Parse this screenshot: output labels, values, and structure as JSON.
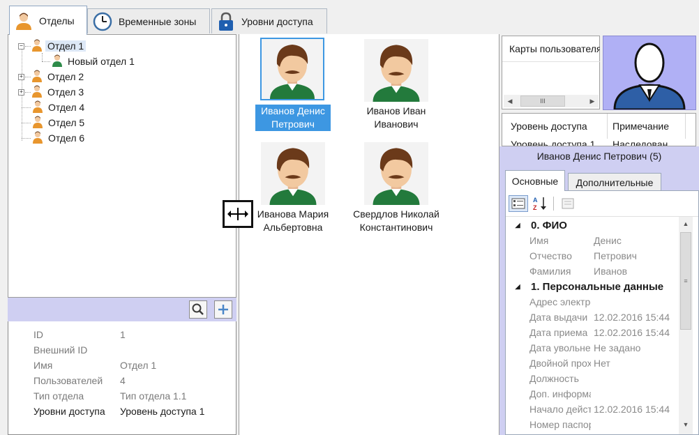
{
  "tabs": [
    {
      "label": "Отделы",
      "icon": "person-icon",
      "active": true
    },
    {
      "label": "Временные зоны",
      "icon": "clock-icon",
      "active": false
    },
    {
      "label": "Уровни доступа",
      "icon": "lock-icon",
      "active": false
    }
  ],
  "tree": {
    "items": [
      {
        "label": "Отдел 1",
        "expander": "−"
      },
      {
        "label": "Новый отдел 1"
      },
      {
        "label": "Отдел 2",
        "expander": "+"
      },
      {
        "label": "Отдел 3",
        "expander": "+"
      },
      {
        "label": "Отдел 4"
      },
      {
        "label": "Отдел 5"
      },
      {
        "label": "Отдел 6"
      }
    ]
  },
  "dept_props": [
    {
      "key": "ID",
      "value": "1"
    },
    {
      "key": "Внешний ID",
      "value": ""
    },
    {
      "key": "Имя",
      "value": "Отдел 1"
    },
    {
      "key": "Пользователей",
      "value": "4"
    },
    {
      "key": "Тип отдела",
      "value": "Тип отдела 1.1"
    },
    {
      "key": "Уровни доступа",
      "value": "Уровень доступа 1"
    }
  ],
  "people": [
    {
      "line1": "Иванов Денис",
      "line2": "Петрович",
      "selected": true
    },
    {
      "line1": "Иванов Иван",
      "line2": "Иванович",
      "selected": false
    },
    {
      "line1": "Иванова Мария",
      "line2": "Альбертовна",
      "selected": false
    },
    {
      "line1": "Свердлов Николай",
      "line2": "Константинович",
      "selected": false
    }
  ],
  "cards": {
    "header": "Карты пользователя",
    "scroll_thumb": "III"
  },
  "access": {
    "col1": "Уровень доступа",
    "col2": "Примечание",
    "row1_col1": "Уровень доступа 1",
    "row1_col2": "Наследован"
  },
  "user_panel": {
    "title": "Иванов Денис Петрович (5)",
    "tab_main": "Основные",
    "tab_extra": "Дополнительные",
    "sort_label": "A Z",
    "categories": [
      {
        "title": "0. ФИО",
        "rows": [
          {
            "key": "Имя",
            "value": "Денис"
          },
          {
            "key": "Отчество",
            "value": "Петрович"
          },
          {
            "key": "Фамилия",
            "value": "Иванов"
          }
        ]
      },
      {
        "title": "1. Персональные данные",
        "rows": [
          {
            "key": "Адрес электронной почты",
            "value": ""
          },
          {
            "key": "Дата выдачи",
            "value": "12.02.2016 15:44"
          },
          {
            "key": "Дата приема",
            "value": "12.02.2016 15:44"
          },
          {
            "key": "Дата увольнения",
            "value": "Не задано"
          },
          {
            "key": "Двойной проход",
            "value": "Нет"
          },
          {
            "key": "Должность",
            "value": ""
          },
          {
            "key": "Доп. информация",
            "value": ""
          },
          {
            "key": "Начало действия",
            "value": "12.02.2016 15:44"
          },
          {
            "key": "Номер паспорта",
            "value": ""
          }
        ]
      }
    ]
  },
  "colors": {
    "selection": "#3d97e2",
    "lilac": "#cfcff2",
    "avatar_bg": "#b0b0f5"
  }
}
